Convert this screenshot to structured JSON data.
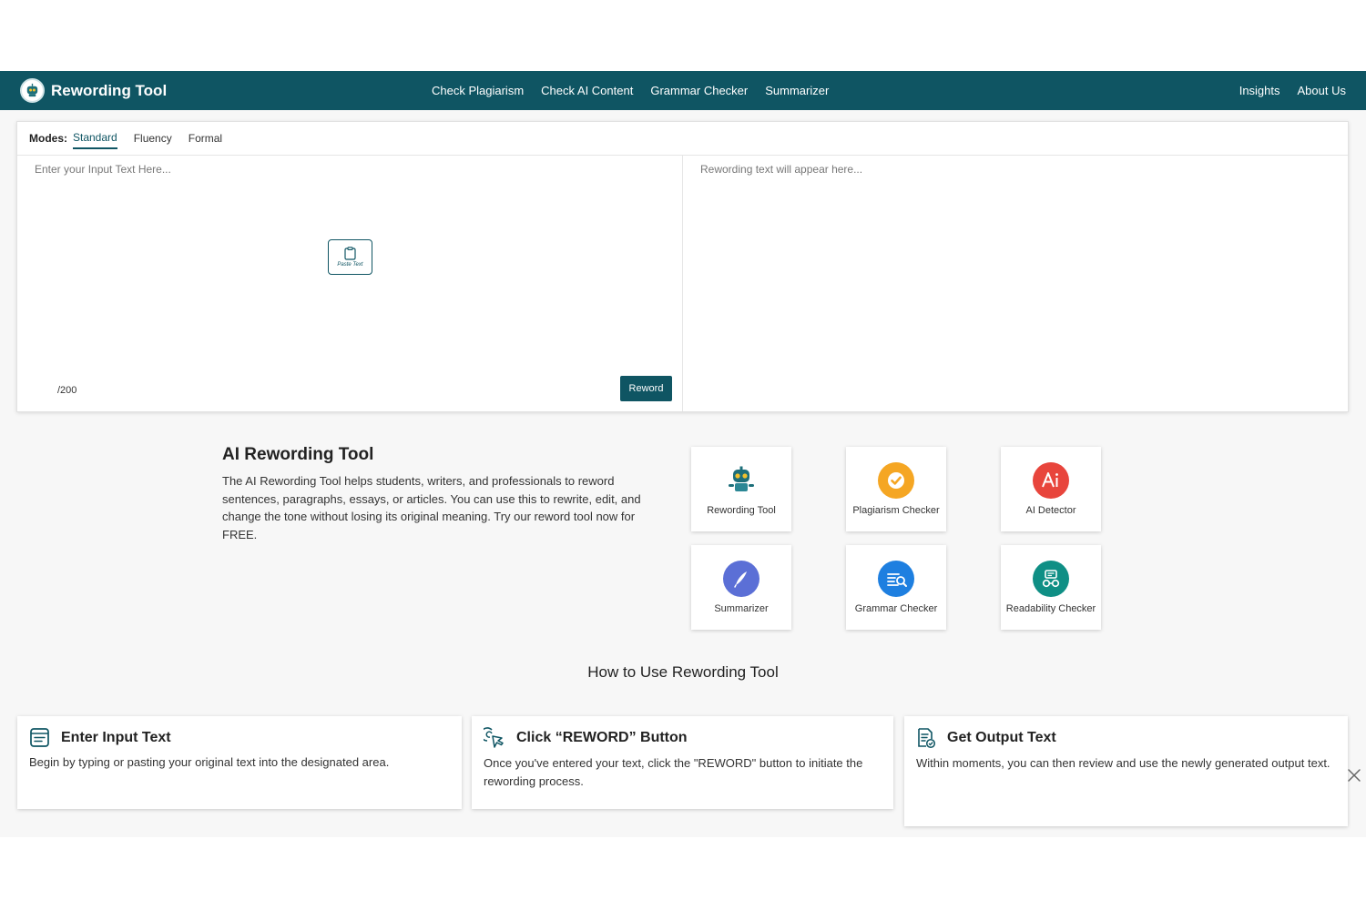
{
  "header": {
    "brand": "Rewording Tool",
    "nav_center": [
      "Check Plagiarism",
      "Check AI Content",
      "Grammar Checker",
      "Summarizer"
    ],
    "nav_right": [
      "Insights",
      "About Us"
    ],
    "color": "#0f5563"
  },
  "tool": {
    "modes_label": "Modes:",
    "modes": [
      "Standard",
      "Fluency",
      "Formal"
    ],
    "active_mode": "Standard",
    "input_placeholder": "Enter your Input Text Here...",
    "output_placeholder": "Rewording text will appear here...",
    "paste_label": "Paste Text",
    "counter": "/200",
    "reword_label": "Reword"
  },
  "about": {
    "title": "AI Rewording Tool",
    "text": "The AI Rewording Tool helps students, writers, and professionals to reword sentences, paragraphs, essays, or articles. You can use this to rewrite, edit, and change the tone without losing its original meaning. Try our reword tool now for FREE."
  },
  "tools": [
    {
      "label": "Rewording Tool",
      "icon": "robot-icon",
      "color": "#ffffff"
    },
    {
      "label": "Plagiarism Checker",
      "icon": "check-badge-icon",
      "color": "#f5a623"
    },
    {
      "label": "AI Detector",
      "icon": "ai-icon",
      "color": "#e8453c"
    },
    {
      "label": "Summarizer",
      "icon": "pen-icon",
      "color": "#5b6fd6"
    },
    {
      "label": "Grammar Checker",
      "icon": "grammar-search-icon",
      "color": "#1e7fe0"
    },
    {
      "label": "Readability Checker",
      "icon": "glasses-icon",
      "color": "#0f8f85"
    }
  ],
  "howto": {
    "title": "How to Use Rewording Tool",
    "steps": [
      {
        "title": "Enter Input Text",
        "text": "Begin by typing or pasting your original text into the designated area.",
        "icon": "text-input-icon"
      },
      {
        "title": "Click “REWORD” Button",
        "text": "Once you've entered your text, click the \"REWORD\" button to initiate the rewording process.",
        "icon": "cursor-click-icon"
      },
      {
        "title": "Get Output Text",
        "text": "Within moments, you can then review and use the newly generated output text.",
        "icon": "document-check-icon"
      }
    ]
  }
}
